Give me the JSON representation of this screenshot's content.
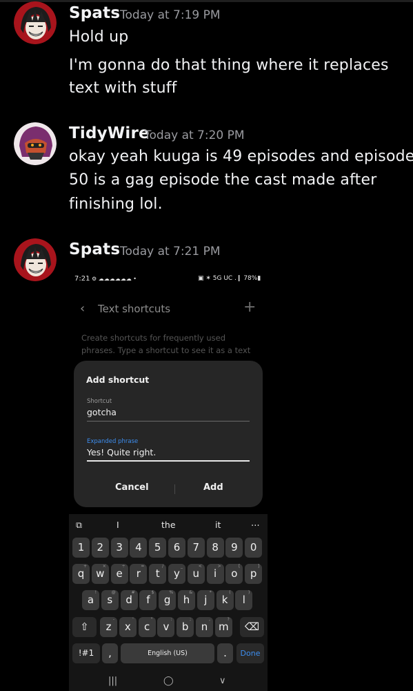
{
  "messages": [
    {
      "username": "Spats",
      "timestamp": "Today at 7:19 PM",
      "lines": [
        "Hold up",
        "I'm gonna do that thing where it replaces",
        "text with stuff"
      ]
    },
    {
      "username": "TidyWire",
      "timestamp": "Today at 7:20 PM",
      "lines": [
        "okay yeah kuuga is 49 episodes and episode",
        "50 is a gag episode the cast made after",
        "finishing lol."
      ]
    },
    {
      "username": "Spats",
      "timestamp": "Today at 7:21 PM",
      "lines": []
    }
  ],
  "attachment": {
    "status_bar": {
      "time": "7:21",
      "notif_icons": "⚙ ☁☁☁☁☁☁ •",
      "right": "▣ ✶ 5G UC .❙ 78%▮"
    },
    "header": {
      "back_icon": "‹",
      "title": "Text shortcuts",
      "add_icon": "+"
    },
    "description": [
      "Create shortcuts for frequently used",
      "phrases. Type a shortcut to see it as a text"
    ],
    "dialog": {
      "title": "Add shortcut",
      "shortcut_label": "Shortcut",
      "shortcut_value": "gotcha",
      "phrase_label": "Expanded phrase",
      "phrase_value": "Yes! Quite right.",
      "cancel_label": "Cancel",
      "add_label": "Add"
    },
    "keyboard": {
      "suggestion_icon": "⧉",
      "suggestions": [
        "I",
        "the",
        "it"
      ],
      "more_icon": "⋯",
      "number_row": [
        "1",
        "2",
        "3",
        "4",
        "5",
        "6",
        "7",
        "8",
        "9",
        "0"
      ],
      "row1": [
        "q",
        "w",
        "e",
        "r",
        "t",
        "y",
        "u",
        "i",
        "o",
        "p"
      ],
      "row1_sup": [
        "+",
        "×",
        "÷",
        "=",
        "/",
        "_",
        "<",
        ">",
        "[",
        "]"
      ],
      "row2": [
        "a",
        "s",
        "d",
        "f",
        "g",
        "h",
        "j",
        "k",
        "l"
      ],
      "row2_sup": [
        "!",
        "@",
        "#",
        "$",
        "%",
        "&",
        "*",
        "(",
        ")"
      ],
      "row3": [
        "z",
        "x",
        "c",
        "v",
        "b",
        "n",
        "m"
      ],
      "row3_sup": [
        "-",
        "'",
        "\"",
        ":",
        ";",
        ",",
        "?"
      ],
      "shift_icon": "⇧",
      "backspace_icon": "⌫",
      "numsym_label": "!#1",
      "comma_label": ",",
      "space_label": "English (US)",
      "period_label": ".",
      "done_label": "Done"
    },
    "nav": {
      "recents": "|||",
      "home": "◯",
      "back": "∨"
    }
  },
  "colors": {
    "background": "#000000",
    "accent": "#3d8ef0",
    "dialog": "#262626",
    "key": "#3a3a3a"
  }
}
